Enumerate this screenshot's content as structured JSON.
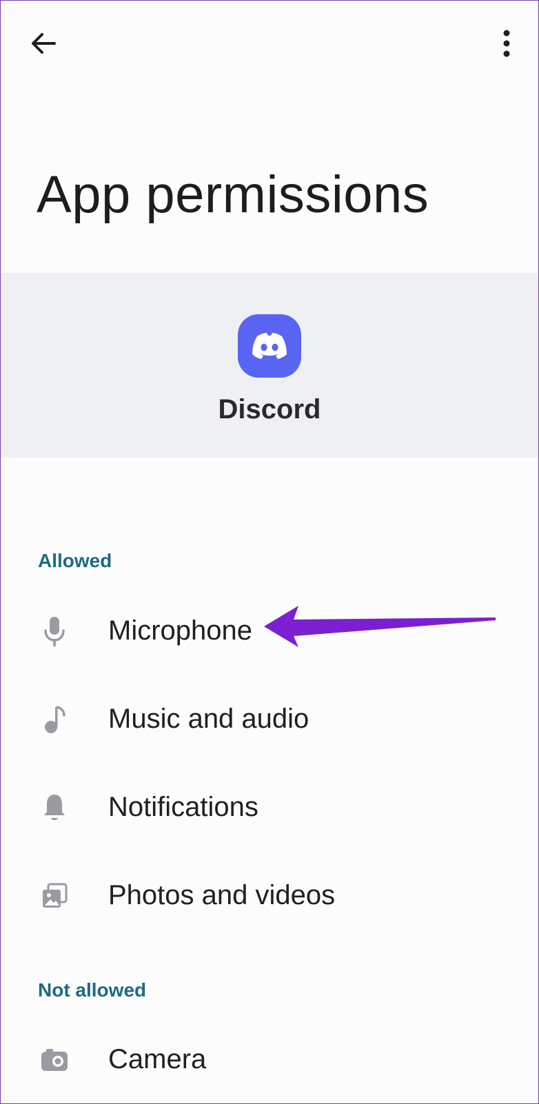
{
  "topbar": {
    "back_icon": "arrow-back-icon",
    "more_icon": "more-vert-icon"
  },
  "page": {
    "title": "App permissions"
  },
  "app": {
    "name": "Discord",
    "icon": "discord-logo-icon",
    "brand_color": "#5865F2"
  },
  "sections": {
    "allowed_label": "Allowed",
    "not_allowed_label": "Not allowed"
  },
  "permissions": {
    "allowed": [
      {
        "label": "Microphone",
        "icon": "microphone-icon"
      },
      {
        "label": "Music and audio",
        "icon": "music-note-icon"
      },
      {
        "label": "Notifications",
        "icon": "bell-icon"
      },
      {
        "label": "Photos and videos",
        "icon": "photos-icon"
      }
    ],
    "not_allowed": [
      {
        "label": "Camera",
        "icon": "camera-icon"
      }
    ]
  },
  "colors": {
    "section_label": "#1E6A80",
    "header_background": "#EFF0F3",
    "annotation_arrow": "#7B1FD0",
    "icon_gray": "#9A9AA0"
  }
}
